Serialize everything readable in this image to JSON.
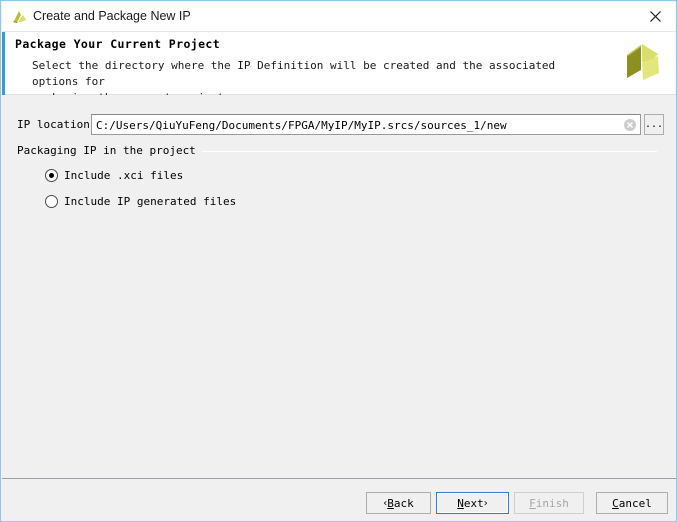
{
  "window": {
    "title": "Create and Package New IP",
    "title_icon": "vivado-app-icon",
    "close_label": "close-icon"
  },
  "banner": {
    "title": "Package Your Current Project",
    "description_line1": "Select the directory where the IP Definition will be created and the associated options for",
    "description_line2": "packaging the current project.",
    "logo": "xilinx-logo",
    "stripe_color": "#3a9ec4"
  },
  "form": {
    "ip_location_label": "IP location:",
    "ip_location_value": "C:/Users/QiuYuFeng/Documents/FPGA/MyIP/MyIP.srcs/sources_1/new",
    "ip_location_placeholder": "",
    "clear_icon": "clear-circle-icon",
    "browse_label": "...",
    "group_label": "Packaging IP in the project",
    "radios": [
      {
        "label": "Include .xci files",
        "checked": true
      },
      {
        "label": "Include IP generated files",
        "checked": false
      }
    ]
  },
  "footer": {
    "buttons": [
      {
        "id": "back",
        "prefix": "‹ ",
        "mnemonic": "B",
        "rest": "ack",
        "suffix": "",
        "enabled": true,
        "focused": false
      },
      {
        "id": "next",
        "prefix": "",
        "mnemonic": "N",
        "rest": "ext",
        "suffix": " ›",
        "enabled": true,
        "focused": true
      },
      {
        "id": "finish",
        "prefix": "",
        "mnemonic": "F",
        "rest": "inish",
        "suffix": "",
        "enabled": false,
        "focused": false
      },
      {
        "id": "cancel",
        "prefix": "",
        "mnemonic": "C",
        "rest": "ancel",
        "suffix": "",
        "enabled": true,
        "focused": false
      }
    ]
  },
  "colors": {
    "accent": "#3a9ec4",
    "focus_border": "#2f7fc4",
    "window_border": "#8fc8e8",
    "logo_dark": "#8d8f22",
    "logo_mid": "#c9cf45",
    "logo_light": "#dfe26e"
  }
}
